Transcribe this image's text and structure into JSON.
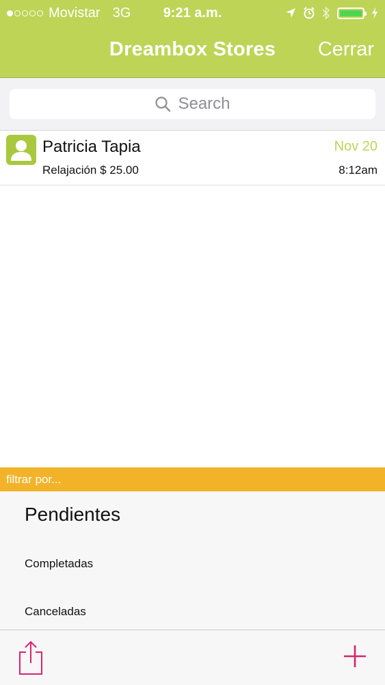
{
  "status_bar": {
    "carrier": "Movistar",
    "network": "3G",
    "time": "9:21 a.m.",
    "battery_level": 1.0,
    "signal_dots_filled": 1,
    "signal_dots_total": 5
  },
  "nav": {
    "title": "Dreambox Stores",
    "close_label": "Cerrar"
  },
  "search": {
    "placeholder": "Search"
  },
  "orders": [
    {
      "name": "Patricia Tapia",
      "detail": "Relajación $ 25.00",
      "date": "Nov 20",
      "time": "8:12am"
    }
  ],
  "filter": {
    "header": "filtrar por...",
    "options": [
      "Pendientes",
      "Completadas",
      "Canceladas"
    ],
    "selected": "Pendientes"
  },
  "colors": {
    "brand_green": "#bdd456",
    "filter_orange": "#f2b329",
    "accent_pink": "#d6246e"
  },
  "icons": {
    "search": "search-icon",
    "avatar": "person-icon",
    "share": "share-icon",
    "add": "plus-icon",
    "location": "location-arrow-icon",
    "alarm": "alarm-icon",
    "bluetooth": "bluetooth-icon",
    "charging": "charging-bolt-icon"
  }
}
